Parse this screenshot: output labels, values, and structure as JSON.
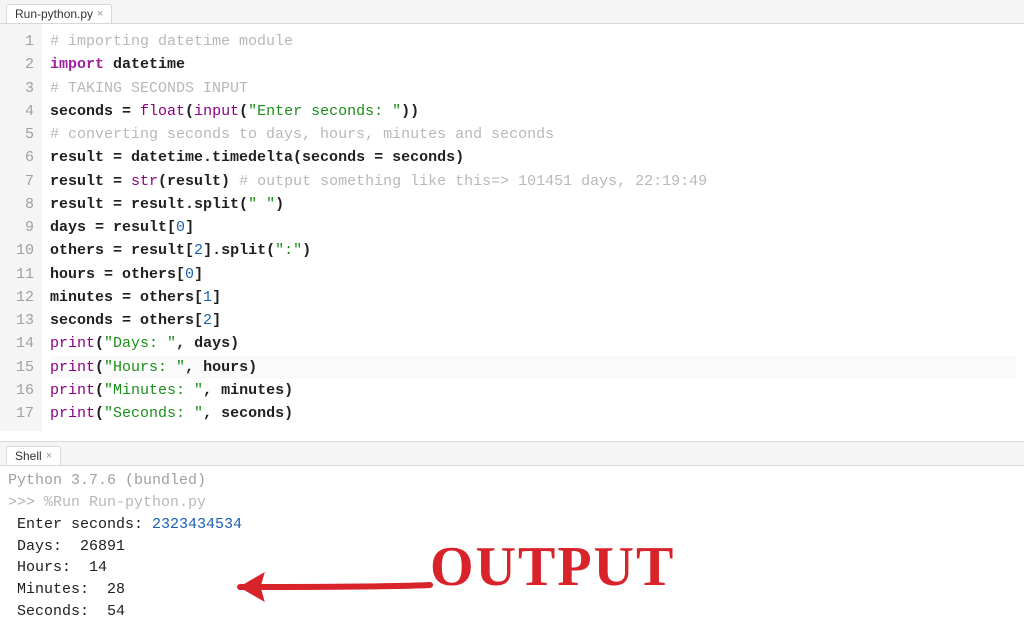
{
  "editor_tab": {
    "label": "Run-python.py"
  },
  "code_lines": [
    {
      "n": 1,
      "tokens": [
        [
          "comment",
          "# importing datetime module"
        ]
      ]
    },
    {
      "n": 2,
      "tokens": [
        [
          "keyword",
          "import"
        ],
        [
          "plain",
          " datetime"
        ]
      ]
    },
    {
      "n": 3,
      "tokens": [
        [
          "comment",
          "# TAKING SECONDS INPUT"
        ]
      ]
    },
    {
      "n": 4,
      "tokens": [
        [
          "plain",
          "seconds = "
        ],
        [
          "builtin",
          "float"
        ],
        [
          "plain",
          "("
        ],
        [
          "builtin",
          "input"
        ],
        [
          "plain",
          "("
        ],
        [
          "string",
          "\"Enter seconds: \""
        ],
        [
          "plain",
          "))"
        ]
      ]
    },
    {
      "n": 5,
      "tokens": [
        [
          "comment",
          "# converting seconds to days, hours, minutes and seconds"
        ]
      ]
    },
    {
      "n": 6,
      "tokens": [
        [
          "plain",
          "result = datetime.timedelta(seconds = seconds)"
        ]
      ]
    },
    {
      "n": 7,
      "tokens": [
        [
          "plain",
          "result = "
        ],
        [
          "builtin",
          "str"
        ],
        [
          "plain",
          "(result) "
        ],
        [
          "comment",
          "# output something like this=> 101451 days, 22:19:49"
        ]
      ]
    },
    {
      "n": 8,
      "tokens": [
        [
          "plain",
          "result = result.split("
        ],
        [
          "string",
          "\" \""
        ],
        [
          "plain",
          ")"
        ]
      ]
    },
    {
      "n": 9,
      "tokens": [
        [
          "plain",
          "days = result["
        ],
        [
          "number",
          "0"
        ],
        [
          "plain",
          "]"
        ]
      ]
    },
    {
      "n": 10,
      "tokens": [
        [
          "plain",
          "others = result["
        ],
        [
          "number",
          "2"
        ],
        [
          "plain",
          "].split("
        ],
        [
          "string",
          "\":\""
        ],
        [
          "plain",
          ")"
        ]
      ]
    },
    {
      "n": 11,
      "tokens": [
        [
          "plain",
          "hours = others["
        ],
        [
          "number",
          "0"
        ],
        [
          "plain",
          "]"
        ]
      ]
    },
    {
      "n": 12,
      "tokens": [
        [
          "plain",
          "minutes = others["
        ],
        [
          "number",
          "1"
        ],
        [
          "plain",
          "]"
        ]
      ]
    },
    {
      "n": 13,
      "tokens": [
        [
          "plain",
          "seconds = others["
        ],
        [
          "number",
          "2"
        ],
        [
          "plain",
          "]"
        ]
      ]
    },
    {
      "n": 14,
      "tokens": [
        [
          "builtin",
          "print"
        ],
        [
          "plain",
          "("
        ],
        [
          "string",
          "\"Days: \""
        ],
        [
          "plain",
          ", days)"
        ]
      ]
    },
    {
      "n": 15,
      "highlight": true,
      "tokens": [
        [
          "builtin",
          "print"
        ],
        [
          "plain",
          "("
        ],
        [
          "string",
          "\"Hours: \""
        ],
        [
          "plain",
          ", hours)"
        ]
      ]
    },
    {
      "n": 16,
      "tokens": [
        [
          "builtin",
          "print"
        ],
        [
          "plain",
          "("
        ],
        [
          "string",
          "\"Minutes: \""
        ],
        [
          "plain",
          ", minutes)"
        ]
      ]
    },
    {
      "n": 17,
      "tokens": [
        [
          "builtin",
          "print"
        ],
        [
          "plain",
          "("
        ],
        [
          "string",
          "\"Seconds: \""
        ],
        [
          "plain",
          ", seconds)"
        ]
      ]
    }
  ],
  "shell_tab": {
    "label": "Shell"
  },
  "shell": {
    "banner": "Python 3.7.6 (bundled)",
    "prompt": ">>>",
    "run_cmd": "%Run Run-python.py",
    "input_prompt": " Enter seconds: ",
    "input_value": "2323434534",
    "out_days": " Days:  26891",
    "out_hours": " Hours:  14",
    "out_minutes": " Minutes:  28",
    "out_seconds": " Seconds:  54"
  },
  "annotation": {
    "text": "OUTPUT"
  }
}
